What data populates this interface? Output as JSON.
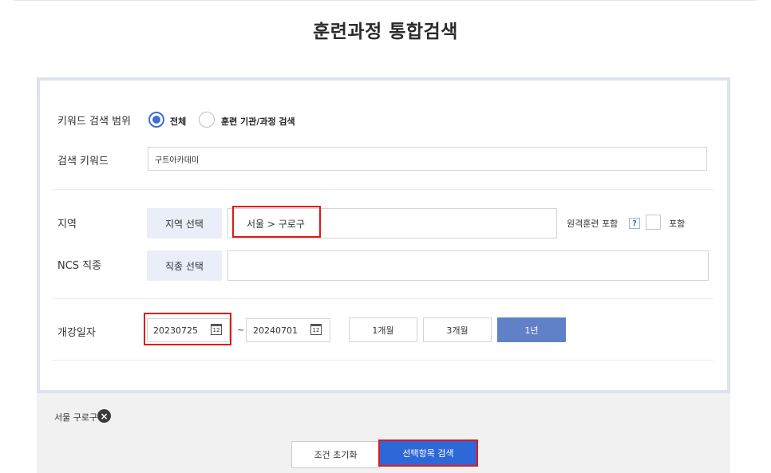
{
  "page": {
    "title": "훈련과정 통합검색"
  },
  "keyword_scope": {
    "label": "키워드 검색 범위",
    "options": [
      {
        "label": "전체",
        "selected": true
      },
      {
        "label": "훈련 기관/과정 검색",
        "selected": false
      }
    ]
  },
  "keyword": {
    "label": "검색 키워드",
    "value": "구트아카데미"
  },
  "region": {
    "label": "지역",
    "button_label": "지역 선택",
    "value": "서울 > 구로구",
    "remote_label": "원격훈련 포함",
    "help": "?",
    "include_label": "포함",
    "include_checked": false
  },
  "ncs": {
    "label": "NCS 직종",
    "button_label": "직종 선택",
    "value": ""
  },
  "open_date": {
    "label": "개강일자",
    "start": "20230725",
    "tilde": "~",
    "end": "20240701",
    "calendar_day": "12",
    "periods": [
      {
        "label": "1개월",
        "active": false
      },
      {
        "label": "3개월",
        "active": false
      },
      {
        "label": "1년",
        "active": true
      }
    ]
  },
  "selected_tags": [
    {
      "label": "서울 구로구"
    }
  ],
  "actions": {
    "reset_label": "조건 초기화",
    "search_label": "선택항목 검색"
  },
  "colors": {
    "accent": "#3f6ed1",
    "search_button": "#2e68d8",
    "active_period": "#6080c8",
    "highlight": "#e01818"
  }
}
